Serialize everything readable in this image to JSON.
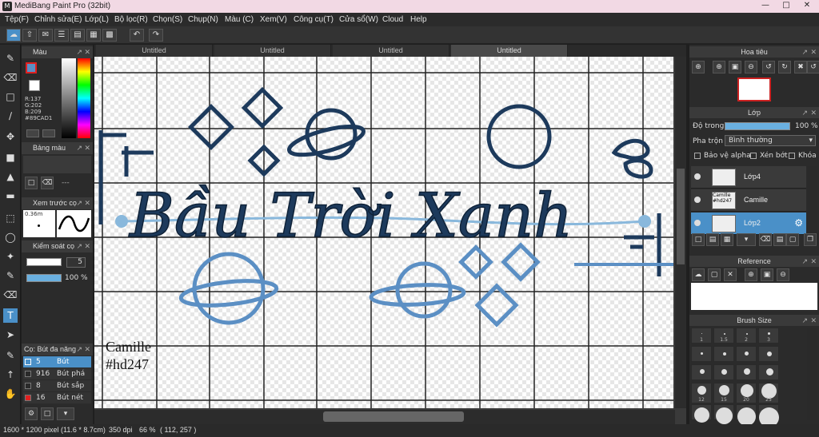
{
  "window": {
    "title": "MediBang Paint Pro (32bit)"
  },
  "menu": [
    "Tệp(F)",
    "Chỉnh sửa(E)",
    "Lớp(L)",
    "Bộ lọc(R)",
    "Chọn(S)",
    "Chụp(N)",
    "Màu (C)",
    "Xem(V)",
    "Công cụ(T)",
    "Cửa sổ(W)",
    "Cloud",
    "Help"
  ],
  "tabs": [
    "Untitled",
    "Untitled",
    "Untitled",
    "Untitled"
  ],
  "color_panel": {
    "title": "Màu",
    "r": "R:137",
    "g": "G:202",
    "b": "B:209",
    "hex": "#89CAD1"
  },
  "color_bar_panel": {
    "title": "Bảng màu"
  },
  "brush_preview": {
    "title": "Xem trước cọ",
    "size": "0.36m"
  },
  "brush_control": {
    "title": "Kiểm soát cọ",
    "size_value": "5",
    "opacity_value": "100 %"
  },
  "brush_list": {
    "title": "Cọ: Bút đa năng",
    "items": [
      {
        "num": "5",
        "label": "Bút",
        "color": "#4a90c8",
        "selected": true
      },
      {
        "num": "916",
        "label": "Bút phá",
        "color": "#2a2a2a",
        "selected": false
      },
      {
        "num": "8",
        "label": "Bút sắp",
        "color": "#2a2a2a",
        "selected": false
      },
      {
        "num": "16",
        "label": "Bút nét",
        "color": "#e02020",
        "selected": false
      }
    ]
  },
  "navigator": {
    "title": "Hoa tiêu"
  },
  "layer_panel": {
    "title": "Lớp",
    "opacity_label": "Độ trong",
    "opacity_value": "100 %",
    "blend_label": "Pha trộn",
    "blend_value": "Bình thường",
    "protect_alpha": "Bảo vệ alpha",
    "clipping": "Xén bớt",
    "lock": "Khóa",
    "layers": [
      {
        "name": "Lớp4",
        "selected": false,
        "thumb_text": ""
      },
      {
        "name": "Camille",
        "selected": false,
        "thumb_text": "Camille #hd247"
      },
      {
        "name": "Lớp2",
        "selected": true,
        "thumb_text": ""
      }
    ]
  },
  "reference_panel": {
    "title": "Reference"
  },
  "brush_size_panel": {
    "title": "Brush Size",
    "sizes": [
      "1",
      "1.5",
      "2",
      "3",
      "",
      "",
      "",
      "",
      "",
      "",
      "",
      "",
      "",
      "",
      "",
      "",
      "12",
      "15",
      "20",
      "25"
    ]
  },
  "canvas": {
    "title_text": "Bầu Trời Xanh",
    "signature_name": "Camille",
    "signature_tag": "#hd247"
  },
  "status": {
    "size": "1600 * 1200 pixel",
    "cm": "(11.6 * 8.7cm)",
    "dpi": "350 dpi",
    "zoom": "66 %",
    "coords": "( 112, 257 )"
  },
  "colors": {
    "accent": "#4a90c8",
    "navy": "#1d3a5c",
    "light_blue": "#89CAD1",
    "mid_blue": "#5b8fc4"
  }
}
